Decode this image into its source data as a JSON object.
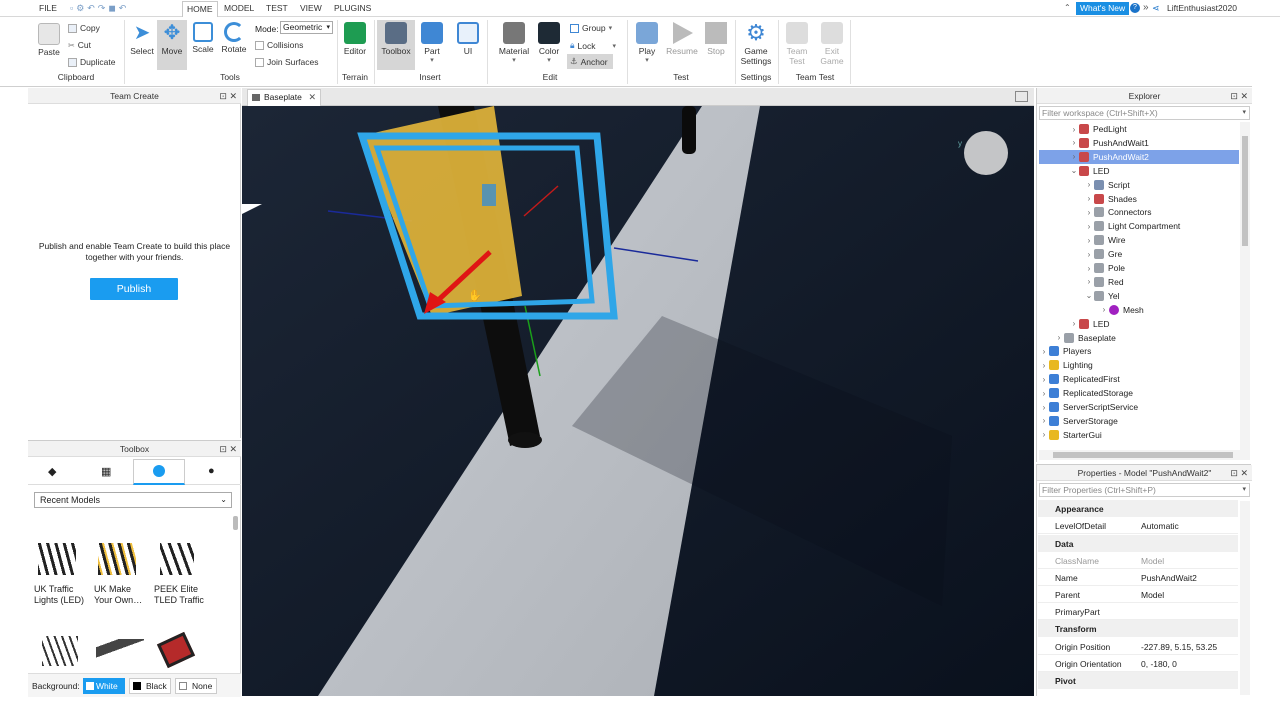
{
  "menu": {
    "file": "FILE",
    "home": "HOME",
    "model": "MODEL",
    "test": "TEST",
    "view": "VIEW",
    "plugins": "PLUGINS"
  },
  "user": {
    "whats_new": "What's New",
    "name": "LiftEnthusiast2020"
  },
  "ribbon": {
    "paste": "Paste",
    "copy": "Copy",
    "cut": "Cut",
    "duplicate": "Duplicate",
    "clipboard": "Clipboard",
    "select": "Select",
    "move": "Move",
    "scale": "Scale",
    "rotate": "Rotate",
    "mode_label": "Mode:",
    "mode_value": "Geometric",
    "collisions": "Collisions",
    "join_surfaces": "Join Surfaces",
    "tools": "Tools",
    "editor": "Editor",
    "terrain": "Terrain",
    "toolbox": "Toolbox",
    "part": "Part",
    "ui": "UI",
    "insert": "Insert",
    "material": "Material",
    "color": "Color",
    "group": "Group",
    "lock": "Lock",
    "anchor": "Anchor",
    "edit": "Edit",
    "play": "Play",
    "resume": "Resume",
    "stop": "Stop",
    "test": "Test",
    "game_settings_1": "Game",
    "game_settings_2": "Settings",
    "settings": "Settings",
    "team_test_1": "Team",
    "team_test_2": "Test",
    "exit_game_1": "Exit",
    "exit_game_2": "Game",
    "team_test_group": "Team Test"
  },
  "team_create": {
    "title": "Team Create",
    "message": "Publish and enable Team Create to build this place together with your friends.",
    "publish": "Publish"
  },
  "toolbox": {
    "title": "Toolbox",
    "dropdown": "Recent Models",
    "items": [
      {
        "name": "UK Traffic Lights (LED)"
      },
      {
        "name": "UK Make Your Own…"
      },
      {
        "name": "PEEK Elite TLED Traffic"
      }
    ],
    "background_label": "Background:",
    "bg_white": "White",
    "bg_black": "Black",
    "bg_none": "None"
  },
  "viewport": {
    "tab": "Baseplate"
  },
  "explorer": {
    "title": "Explorer",
    "filter": "Filter workspace (Ctrl+Shift+X)",
    "rows": [
      {
        "label": "PedLight",
        "indent": 2,
        "icon": "model"
      },
      {
        "label": "PushAndWait1",
        "indent": 2,
        "icon": "model"
      },
      {
        "label": "PushAndWait2",
        "indent": 2,
        "icon": "model",
        "selected": true
      },
      {
        "label": "LED",
        "indent": 2,
        "icon": "model",
        "open": true
      },
      {
        "label": "Script",
        "indent": 3,
        "icon": "script"
      },
      {
        "label": "Shades",
        "indent": 3,
        "icon": "model"
      },
      {
        "label": "Connectors",
        "indent": 3,
        "icon": "part"
      },
      {
        "label": "Light Compartment",
        "indent": 3,
        "icon": "part"
      },
      {
        "label": "Wire",
        "indent": 3,
        "icon": "part"
      },
      {
        "label": "Gre",
        "indent": 3,
        "icon": "part"
      },
      {
        "label": "Pole",
        "indent": 3,
        "icon": "part"
      },
      {
        "label": "Red",
        "indent": 3,
        "icon": "part"
      },
      {
        "label": "Yel",
        "indent": 3,
        "icon": "part",
        "open": true
      },
      {
        "label": "Mesh",
        "indent": 4,
        "icon": "mesh"
      },
      {
        "label": "LED",
        "indent": 2,
        "icon": "model"
      },
      {
        "label": "Baseplate",
        "indent": 1,
        "icon": "part"
      },
      {
        "label": "Players",
        "indent": 0,
        "icon": "players"
      },
      {
        "label": "Lighting",
        "indent": 0,
        "icon": "lighting"
      },
      {
        "label": "ReplicatedFirst",
        "indent": 0,
        "icon": "service"
      },
      {
        "label": "ReplicatedStorage",
        "indent": 0,
        "icon": "service"
      },
      {
        "label": "ServerScriptService",
        "indent": 0,
        "icon": "service"
      },
      {
        "label": "ServerStorage",
        "indent": 0,
        "icon": "service"
      },
      {
        "label": "StarterGui",
        "indent": 0,
        "icon": "gui"
      }
    ]
  },
  "properties": {
    "title": "Properties - Model \"PushAndWait2\"",
    "filter": "Filter Properties (Ctrl+Shift+P)",
    "appearance": "Appearance",
    "level_of_detail_k": "LevelOfDetail",
    "level_of_detail_v": "Automatic",
    "data": "Data",
    "classname_k": "ClassName",
    "classname_v": "Model",
    "name_k": "Name",
    "name_v": "PushAndWait2",
    "parent_k": "Parent",
    "parent_v": "Model",
    "primarypart_k": "PrimaryPart",
    "transform": "Transform",
    "origin_pos_k": "Origin Position",
    "origin_pos_v": "-227.89, 5.15, 53.25",
    "origin_ori_k": "Origin Orientation",
    "origin_ori_v": "0, -180, 0",
    "pivot": "Pivot"
  }
}
